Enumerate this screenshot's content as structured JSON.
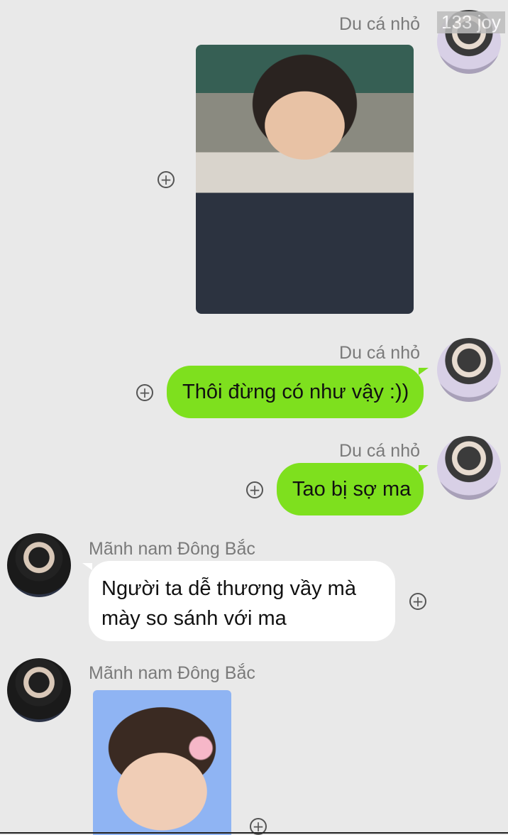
{
  "chat": {
    "messages": [
      {
        "sender": "Du cá nhỏ",
        "direction": "outgoing",
        "type": "image"
      },
      {
        "sender": "Du cá nhỏ",
        "direction": "outgoing",
        "type": "text",
        "text": "Thôi đừng có như vậy :))"
      },
      {
        "sender": "Du cá nhỏ",
        "direction": "outgoing",
        "type": "text",
        "text": "Tao bị sợ ma"
      },
      {
        "sender": "Mãnh nam Đông Bắc",
        "direction": "incoming",
        "type": "text",
        "text": "Người ta dễ thương vầy mà\nmày so sánh với ma"
      },
      {
        "sender": "Mãnh nam Đông Bắc",
        "direction": "incoming",
        "type": "image"
      }
    ]
  },
  "watermark": {
    "label": "133 joy"
  },
  "icons": {
    "plus": "⊕"
  },
  "colors": {
    "background": "#e9e9e9",
    "outgoing_bubble": "#7ee01e",
    "incoming_bubble": "#ffffff",
    "sender_name": "#7a7a7a"
  }
}
